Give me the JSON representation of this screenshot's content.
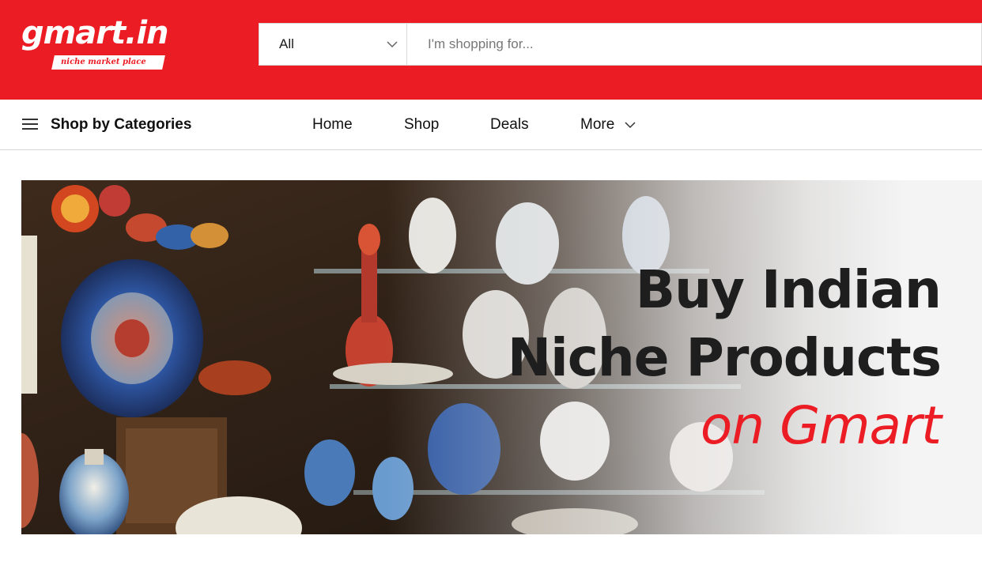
{
  "header": {
    "brand_name": "gmart.in",
    "brand_tagline": "niche market place",
    "category_select": {
      "selected": "All"
    },
    "search_placeholder": "I'm shopping for...",
    "brand_color": "#ec1c24"
  },
  "nav": {
    "categories_label": "Shop by Categories",
    "links": [
      "Home",
      "Shop",
      "Deals",
      "More"
    ],
    "more_icon": "chevron-down-icon",
    "menu_icon": "hamburger-icon"
  },
  "banner": {
    "line1": "Buy Indian",
    "line2": "Niche Products",
    "line3": "on Gmart"
  }
}
